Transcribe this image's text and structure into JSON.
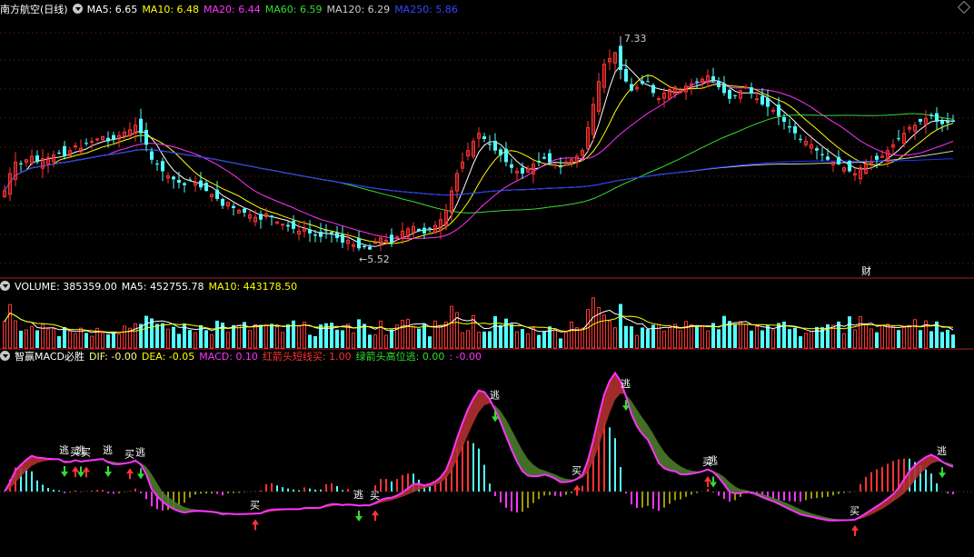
{
  "header": {
    "stock_name": "南方航空(日线)",
    "ma": [
      {
        "label": "MA5: 6.65",
        "color": "#ffffff"
      },
      {
        "label": "MA10: 6.48",
        "color": "#ffff00"
      },
      {
        "label": "MA20: 6.44",
        "color": "#ff33ff"
      },
      {
        "label": "MA60: 6.59",
        "color": "#33dd33"
      },
      {
        "label": "MA120: 6.29",
        "color": "#cccccc"
      },
      {
        "label": "MA250: 5.86",
        "color": "#3344ff"
      }
    ]
  },
  "volume_header": {
    "items": [
      {
        "label": "VOLUME: 385359.00",
        "color": "#ffffff"
      },
      {
        "label": "MA5: 452755.78",
        "color": "#ffffff"
      },
      {
        "label": "MA10: 443178.50",
        "color": "#ffff00"
      }
    ]
  },
  "macd_header": {
    "items": [
      {
        "label": "智赢MACD必胜",
        "color": "#ffffff"
      },
      {
        "label": "DIF: -0.00",
        "color": "#ffff88"
      },
      {
        "label": "DEA: -0.05",
        "color": "#ffff00"
      },
      {
        "label": "MACD: 0.10",
        "color": "#ff33ff"
      },
      {
        "label": "红箭头短线买: 1.00",
        "color": "#ff3333"
      },
      {
        "label": "绿箭头高位逃: 0.00",
        "color": "#33dd33"
      },
      {
        "label": ": -0.00",
        "color": "#ff33ff"
      }
    ]
  },
  "annotations": {
    "price_high": "7.33",
    "price_low": "←5.52",
    "finance_marker": "财",
    "buy_label": "买",
    "escape_label": "逃"
  },
  "colors": {
    "up": "#ff3333",
    "down": "#54ffff",
    "ma5": "#ffffff",
    "ma10": "#ffff00",
    "ma20": "#ff33ff",
    "ma60": "#33dd33",
    "ma120": "#cccccc",
    "ma250": "#2233ff",
    "grid": "#8b1a1a",
    "divider": "#b02020"
  },
  "chart_data": [
    {
      "type": "candlestick",
      "title": "南方航空(日线)",
      "high": 7.33,
      "low": 5.52,
      "ylim": [
        5.3,
        7.55
      ],
      "x": [
        1,
        2,
        3,
        4,
        5,
        6,
        7,
        8,
        9,
        10,
        11,
        12,
        13,
        14,
        15,
        16,
        17,
        18,
        19,
        20,
        21,
        22,
        23,
        24,
        25,
        26,
        27,
        28,
        29,
        30,
        31,
        32,
        33,
        34,
        35,
        36,
        37,
        38,
        39,
        40,
        41,
        42,
        43,
        44,
        45,
        46,
        47,
        48,
        49,
        50,
        51,
        52,
        53,
        54,
        55,
        56,
        57,
        58,
        59,
        60,
        61,
        62,
        63,
        64,
        65,
        66,
        67,
        68,
        69,
        70,
        71,
        72,
        73,
        74,
        75,
        76,
        77,
        78,
        79,
        80,
        81,
        82,
        83,
        84,
        85,
        86,
        87,
        88,
        89,
        90,
        91,
        92,
        93,
        94,
        95,
        96,
        97,
        98,
        99,
        100,
        101,
        102,
        103,
        104,
        105,
        106,
        107,
        108,
        109,
        110,
        111,
        112,
        113,
        114,
        115,
        116,
        117,
        118,
        119,
        120,
        121,
        122,
        123,
        124,
        125,
        126,
        127,
        128,
        129,
        130,
        131,
        132,
        133,
        134,
        135,
        136,
        137,
        138,
        139,
        140,
        141,
        142,
        143,
        144,
        145,
        146,
        147,
        148,
        149,
        150,
        151,
        152,
        153,
        154,
        155,
        156,
        157,
        158,
        159,
        160,
        161,
        162,
        163,
        164,
        165,
        166,
        167,
        168,
        169,
        170,
        171,
        172,
        173,
        174,
        175,
        176,
        177
      ],
      "close": [
        6.05,
        6.2,
        6.3,
        6.28,
        6.32,
        6.35,
        6.3,
        6.33,
        6.34,
        6.36,
        6.38,
        6.35,
        6.4,
        6.44,
        6.42,
        6.46,
        6.48,
        6.5,
        6.52,
        6.48,
        6.5,
        6.53,
        6.56,
        6.58,
        6.62,
        6.55,
        6.45,
        6.32,
        6.28,
        6.22,
        6.18,
        6.15,
        6.12,
        6.1,
        6.14,
        6.12,
        6.08,
        6.05,
        6.02,
        5.98,
        5.92,
        5.95,
        5.9,
        5.88,
        5.86,
        5.84,
        5.82,
        5.8,
        5.85,
        5.82,
        5.78,
        5.76,
        5.74,
        5.72,
        5.7,
        5.72,
        5.68,
        5.66,
        5.65,
        5.7,
        5.68,
        5.64,
        5.6,
        5.62,
        5.58,
        5.55,
        5.56,
        5.54,
        5.6,
        5.64,
        5.62,
        5.6,
        5.65,
        5.7,
        5.72,
        5.74,
        5.7,
        5.68,
        5.72,
        5.75,
        5.8,
        5.88,
        6.05,
        6.2,
        6.3,
        6.4,
        6.48,
        6.55,
        6.5,
        6.45,
        6.4,
        6.36,
        6.3,
        6.25,
        6.22,
        6.2,
        6.24,
        6.28,
        6.3,
        6.33,
        6.3,
        6.28,
        6.26,
        6.3,
        6.32,
        6.35,
        6.4,
        6.6,
        6.8,
        7.0,
        7.15,
        7.2,
        7.25,
        7.1,
        7.0,
        6.92,
        6.95,
        6.98,
        7.0,
        6.9,
        6.85,
        6.9,
        6.93,
        6.95,
        6.92,
        6.96,
        6.98,
        7.0,
        7.02,
        7.05,
        7.0,
        6.95,
        6.9,
        6.85,
        6.88,
        6.92,
        6.95,
        6.9,
        6.85,
        6.8,
        6.78,
        6.75,
        6.7,
        6.65,
        6.6,
        6.55,
        6.5,
        6.48,
        6.45,
        6.4,
        6.36,
        6.32,
        6.3,
        6.28,
        6.25,
        6.22,
        6.2,
        6.25,
        6.28,
        6.3,
        6.32,
        6.35,
        6.4,
        6.45,
        6.5,
        6.55,
        6.6,
        6.62,
        6.65,
        6.68,
        6.7,
        6.65,
        6.63,
        6.64,
        6.65
      ]
    },
    {
      "type": "bar",
      "title": "VOLUME",
      "values": [
        385359
      ]
    },
    {
      "type": "bar",
      "title": "智赢MACD必胜",
      "series": [
        {
          "name": "DIF",
          "values": [
            -0.0
          ]
        },
        {
          "name": "DEA",
          "values": [
            -0.05
          ]
        },
        {
          "name": "MACD",
          "values": [
            0.1
          ]
        }
      ]
    }
  ]
}
